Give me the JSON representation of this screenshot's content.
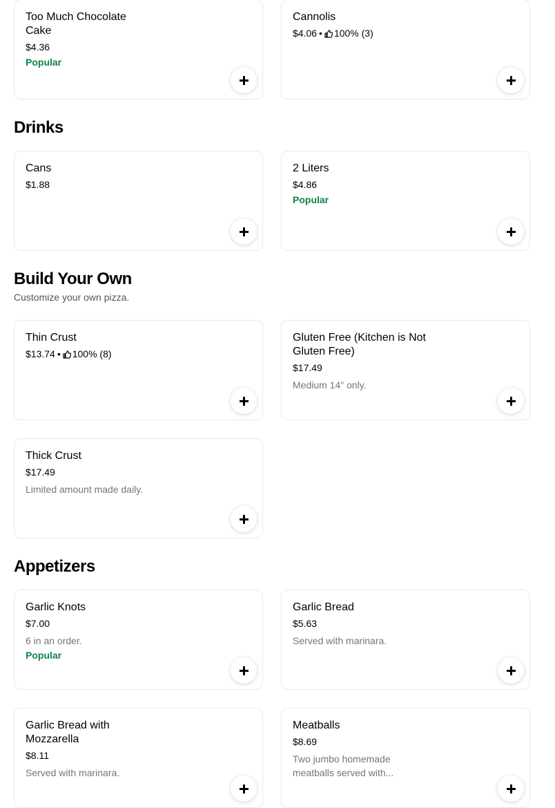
{
  "sections": {
    "desserts": {
      "items": [
        {
          "name": "Too Much Chocolate Cake",
          "price": "$4.36",
          "popular": "Popular"
        },
        {
          "name": "Cannolis",
          "price": "$4.06",
          "separator": "•",
          "rating": "100% (3)",
          "rating_icon": "thumbs-up-icon"
        }
      ]
    },
    "drinks": {
      "title": "Drinks",
      "items": [
        {
          "name": "Cans",
          "price": "$1.88"
        },
        {
          "name": "2 Liters",
          "price": "$4.86",
          "popular": "Popular"
        }
      ]
    },
    "build_your_own": {
      "title": "Build Your Own",
      "subtitle": "Customize your own pizza.",
      "items": [
        {
          "name": "Thin Crust",
          "price": "$13.74",
          "separator": "•",
          "rating": "100% (8)",
          "rating_icon": "thumbs-up-icon"
        },
        {
          "name": "Gluten Free (Kitchen is Not Gluten Free)",
          "price": "$17.49",
          "description": "Medium 14\" only."
        },
        {
          "name": "Thick Crust",
          "price": "$17.49",
          "description": "Limited amount made daily."
        }
      ]
    },
    "appetizers": {
      "title": "Appetizers",
      "items": [
        {
          "name": "Garlic Knots",
          "price": "$7.00",
          "description": "6 in an order.",
          "popular": "Popular"
        },
        {
          "name": "Garlic Bread",
          "price": "$5.63",
          "description": "Served with marinara."
        },
        {
          "name": "Garlic Bread with Mozzarella",
          "price": "$8.11",
          "description": "Served with marinara."
        },
        {
          "name": "Meatballs",
          "price": "$8.69",
          "description": "Two jumbo homemade meatballs served with..."
        }
      ]
    }
  },
  "add_button_icon": "plus-icon",
  "colors": {
    "popular": "#0e8345",
    "description": "#757575",
    "card_border": "#e8e8e8"
  }
}
